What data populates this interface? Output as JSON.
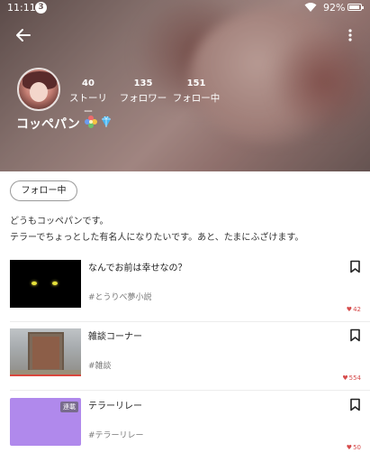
{
  "status_bar": {
    "time": "11:11",
    "notification_count": "3",
    "battery": "92%",
    "battery_level": 0.92
  },
  "profile": {
    "username": "コッペパン",
    "stats": [
      {
        "value": "40",
        "label": "ストーリー"
      },
      {
        "value": "135",
        "label": "フォロワー"
      },
      {
        "value": "151",
        "label": "フォロー中"
      }
    ],
    "badges": [
      "flower-badge-icon",
      "diamond-badge-icon"
    ],
    "follow_button_label": "フォロー中",
    "bio_line1": "どうもコッペパンです。",
    "bio_line2": "テラーでちょっとした有名人になりたいです。あと、たまにふざけます。"
  },
  "stories": [
    {
      "title": "なんでお前は幸せなの？",
      "tag": "#とうりべ夢小説",
      "likes": "42",
      "thumbnail": "black-cat-eyes"
    },
    {
      "title": "雑談コーナー",
      "tag": "#雑談",
      "likes": "554",
      "thumbnail": "old-door"
    },
    {
      "title": "テラーリレー",
      "tag": "#テラーリレー",
      "likes": "50",
      "thumbnail": "purple",
      "thumbnail_label": "連載"
    }
  ],
  "colors": {
    "like_red": "#d64b4b",
    "purple_thumb": "#b089ec"
  }
}
